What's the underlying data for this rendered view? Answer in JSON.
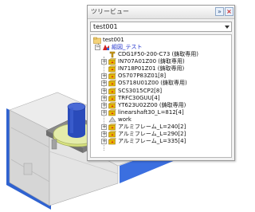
{
  "panel": {
    "title": "ツリービュー",
    "pin_glyph": "»",
    "close_glyph": "×",
    "selector_value": "test001"
  },
  "tree": {
    "root_label": "test001",
    "group_label": "組図_テスト",
    "items": [
      {
        "label": "CDG1F50-200-C73 (鋳取専用)",
        "icon": "bolt-icon",
        "expandable": false
      },
      {
        "label": "IN707A01Z00 (鋳取専用)",
        "icon": "part-icon",
        "expandable": true
      },
      {
        "label": "IN718P01Z01 (鋳取専用)",
        "icon": "part-icon",
        "expandable": false
      },
      {
        "label": "OS707P83Z01[8]",
        "icon": "part-icon",
        "expandable": true
      },
      {
        "label": "OS718U01Z00 (鋳取専用)",
        "icon": "part-icon",
        "expandable": true
      },
      {
        "label": "SCS3015CP2[8]",
        "icon": "part-icon",
        "expandable": true
      },
      {
        "label": "TRFC30GUU[4]",
        "icon": "part-icon",
        "expandable": true
      },
      {
        "label": "YT623U02Z00 (鋳取専用)",
        "icon": "part-icon",
        "expandable": true
      },
      {
        "label": "linearshaft30_L=812[4]",
        "icon": "part-icon",
        "expandable": true
      },
      {
        "label": "work",
        "icon": "work-icon",
        "expandable": false
      },
      {
        "label": "アルミフレーム_L=240[2]",
        "icon": "part-icon",
        "expandable": true
      },
      {
        "label": "アルミフレーム_L=290[2]",
        "icon": "part-icon",
        "expandable": true
      },
      {
        "label": "アルミフレーム_L=335[4]",
        "icon": "part-icon",
        "expandable": true
      }
    ]
  },
  "colors": {
    "group_label": "#2233cc",
    "part_yellow": "#e6b800",
    "part_red": "#d02020",
    "model_frame": "#e2e2e2",
    "model_blue_edge": "#2a5ccc",
    "model_plate_green": "#dfe89a",
    "model_cylinder": "#2647b8"
  }
}
